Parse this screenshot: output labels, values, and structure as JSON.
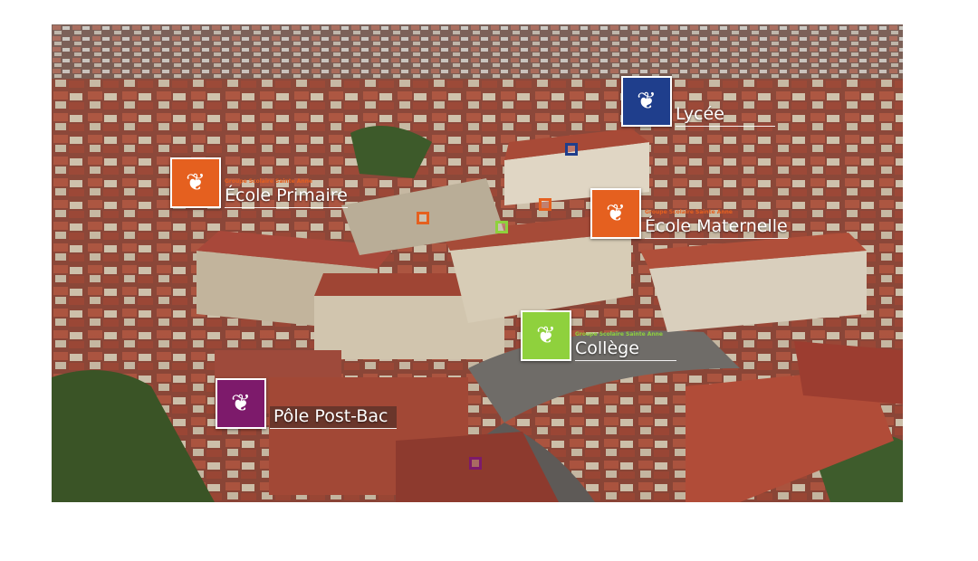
{
  "photo": {
    "description_colors": {
      "roof": "#9b3a2c",
      "roof_light": "#b8523d",
      "wall": "#cfc2ab",
      "vegetation": "#3d5a2a"
    }
  },
  "labels": [
    {
      "id": "lycee",
      "name": "Lycée",
      "group": "",
      "color": "#1f3e8c"
    },
    {
      "id": "primaire",
      "name": "École Primaire",
      "group": "Groupe Scolaire Sainte Anne",
      "color": "#e5601f"
    },
    {
      "id": "maternelle",
      "name": "École Maternelle",
      "group": "Groupe Scolaire Sainte Anne",
      "color": "#e5601f"
    },
    {
      "id": "college",
      "name": "Collège",
      "group": "Groupe Scolaire Sainte Anne",
      "color": "#8fd13d"
    },
    {
      "id": "postbac",
      "name": "Pôle Post-Bac",
      "group": "",
      "color": "#7d1a6b"
    }
  ],
  "markers": [
    {
      "id": "marker-lycee",
      "color": "#1f3e8c"
    },
    {
      "id": "marker-primaire",
      "color": "#e5601f"
    },
    {
      "id": "marker-maternelle",
      "color": "#e5601f"
    },
    {
      "id": "marker-college",
      "color": "#8fd13d"
    },
    {
      "id": "marker-postbac",
      "color": "#7d1a6b"
    }
  ]
}
